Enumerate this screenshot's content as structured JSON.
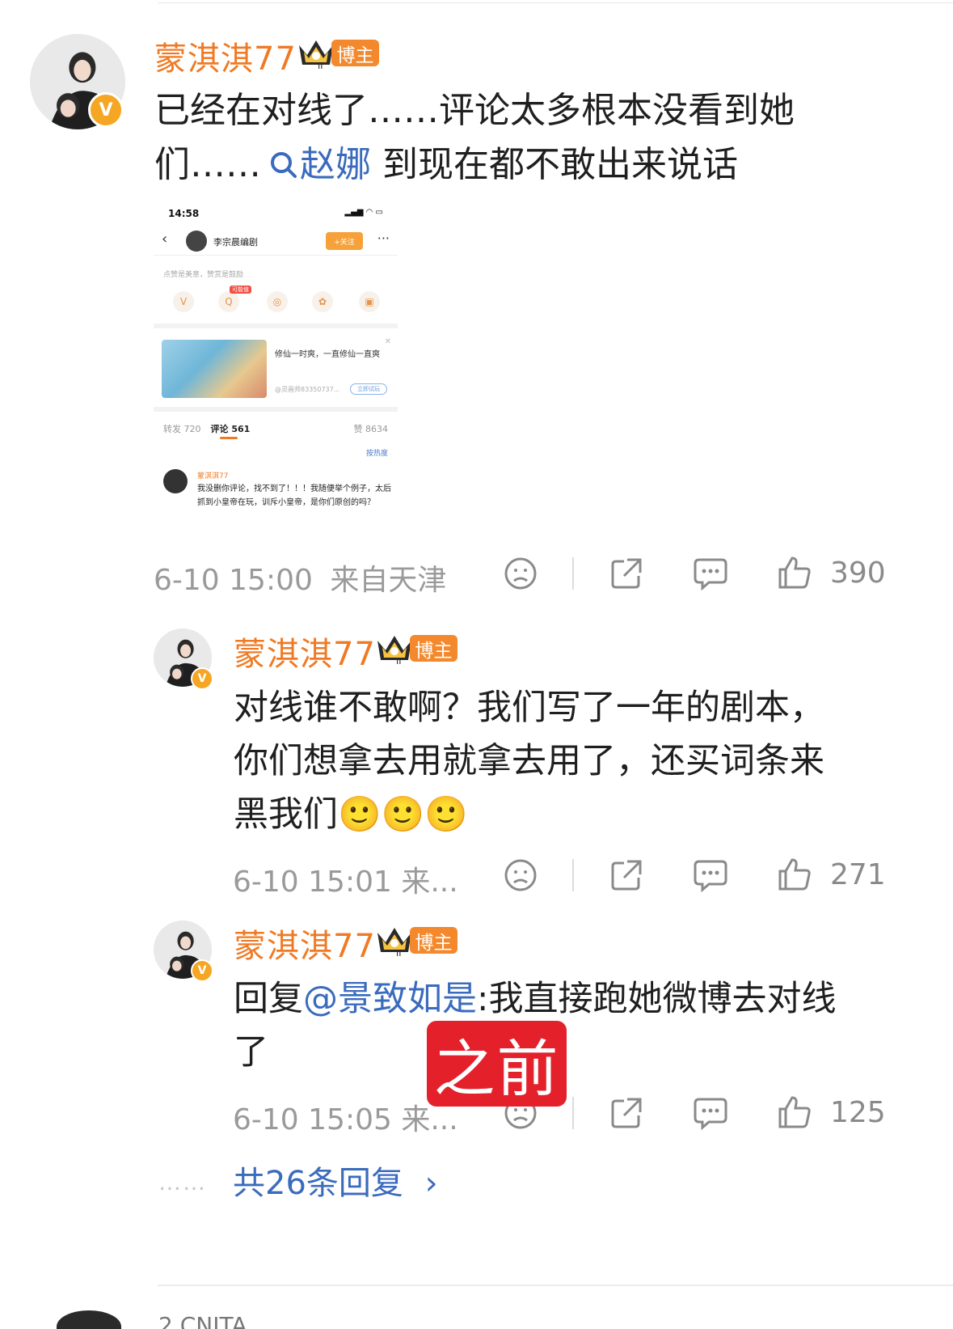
{
  "colors": {
    "username": "#f07a24",
    "link": "#3a6bbd",
    "tag_bg": "#f3892c",
    "stamp_bg": "#e4202b",
    "meta": "#9a9a9a"
  },
  "main_post": {
    "username": "蒙淇淇77",
    "tag": "博主",
    "text_1": "已经在对线了……评论太多根本没看到她",
    "text_2_prefix": "们……",
    "search_icon": "search-icon",
    "topic_link": "赵娜",
    "text_2_suffix": " 到现在都不敢出来说话",
    "time": "6-10 15:00",
    "location": "来自天津",
    "likes": "390"
  },
  "embedded_screenshot": {
    "status_time": "14:58",
    "header_name": "李宗晨编剧",
    "follow_label": "+关注",
    "tip": "点赞是美意，赞赏是鼓励",
    "hot_badge": "可能值",
    "ad_text": "修仙一时爽，一直修仙一直爽",
    "ad_sub": "@灵画师83350737...",
    "ad_button": "立即试玩",
    "tab_repost": "转发 720",
    "tab_comment": "评论 561",
    "tab_like": "赞 8634",
    "sort_label": "按热度",
    "comment_name": "蒙淇淇77",
    "comment_text": "我没删你评论，找不到了！！！我随便举个例子，太后抓到小皇帝在玩，训斥小皇帝，是你们原创的吗？"
  },
  "replies": [
    {
      "username": "蒙淇淇77",
      "tag": "博主",
      "line_1": "对线谁不敢啊？我们写了一年的剧本，",
      "line_2": "你们想拿去用就拿去用了，还买词条来",
      "line_3": "黑我们🙂🙂🙂",
      "time": "6-10 15:01 来...",
      "likes": "271"
    },
    {
      "username": "蒙淇淇77",
      "tag": "博主",
      "prefix": "回复",
      "mention": "@景致如是",
      "line_1_rest": ":我直接跑她微博去对线",
      "line_2": "了",
      "time": "6-10 15:05 来...",
      "likes": "125"
    }
  ],
  "stamp": "之前",
  "more_replies": "共26条回复",
  "more_dots": "……",
  "next_comment_peek": "2 CNITA"
}
